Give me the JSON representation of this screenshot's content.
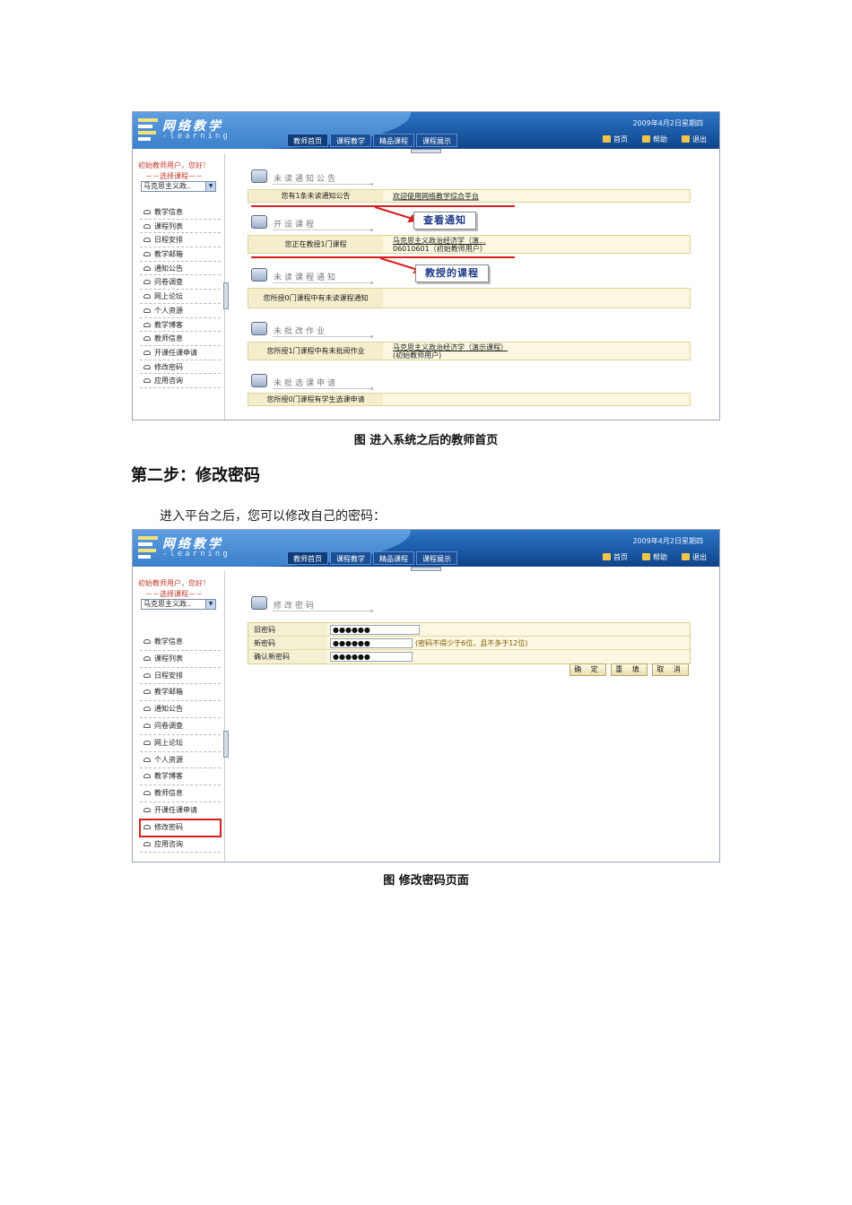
{
  "portal": {
    "logo_title": "网络教学",
    "logo_sub": "-learning",
    "date": "2009年4月2日星期四",
    "nav_tabs": [
      "教师首页",
      "课程教学",
      "精品课程",
      "课程展示"
    ],
    "top_links": [
      "首页",
      "帮助",
      "退出"
    ],
    "greeting": "初始教师用户，您好！",
    "choose_course": "－－选择课程－－",
    "course_select_value": "马克思主义政..",
    "sidebar_items": [
      "教学信息",
      "课程列表",
      "日程安排",
      "教学邮箱",
      "通知公告",
      "问卷调查",
      "网上论坛",
      "个人资源",
      "教学博客",
      "教师信息",
      "开课任课申请",
      "修改密码",
      "应用咨询"
    ]
  },
  "home": {
    "sections": [
      {
        "title": "未读通知公告",
        "label": "您有1条未读通知公告",
        "value": "欢迎使用网络教学综合平台"
      },
      {
        "title": "开设课程",
        "label": "您正在教授1门课程",
        "value_line1": "马克思主义政治经济学（演...",
        "value_line2": "06010601（初始教师用户）"
      },
      {
        "title": "未读课程通知",
        "label": "您所授0门课程中有未读课程通知",
        "value": ""
      },
      {
        "title": "未批改作业",
        "label": "您所授1门课程中有未批阅作业",
        "value_line1": "马克思主义政治经济学（演示课程）",
        "value_line2": "(初始教师用户)"
      },
      {
        "title": "未批选课申请",
        "label": "您所授0门课程有学生选课申请",
        "value": ""
      }
    ],
    "callouts": [
      "查看通知",
      "教授的课程"
    ]
  },
  "caption1": "图  进入系统之后的教师首页",
  "step_heading": "第二步：修改密码",
  "step_para": "进入平台之后，您可以修改自己的密码：",
  "password": {
    "title": "修改密码",
    "fields": [
      {
        "label": "旧密码",
        "value": "●●●●●●"
      },
      {
        "label": "新密码",
        "value": "●●●●●●",
        "hint": "(密码不得少于6位，且不多于12位)"
      },
      {
        "label": "确认新密码",
        "value": "●●●●●●"
      }
    ],
    "buttons": [
      "确 定",
      "重 填",
      "取 消"
    ]
  },
  "caption2": "图  修改密码页面"
}
